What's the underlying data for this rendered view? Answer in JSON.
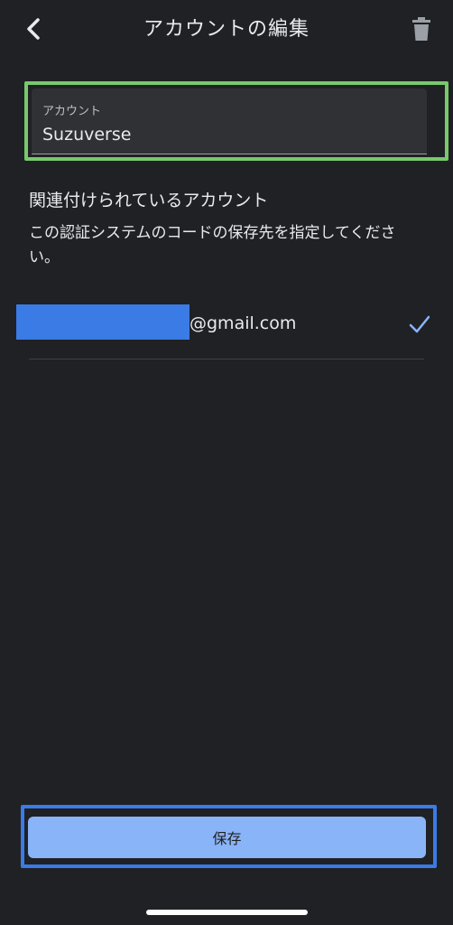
{
  "header": {
    "title": "アカウントの編集",
    "back_icon": "chevron-left-icon",
    "delete_icon": "trash-icon"
  },
  "account_field": {
    "label": "アカウント",
    "value": "Suzuverse"
  },
  "linked_account": {
    "title": "関連付けられているアカウント",
    "description": "この認証システムのコードの保存先を指定してください。",
    "email_domain": "@gmail.com",
    "selected": true,
    "check_icon": "check-icon"
  },
  "save_button": {
    "label": "保存"
  },
  "colors": {
    "background": "#202124",
    "field_highlight": "#77c96b",
    "save_highlight": "#3a7be5",
    "redaction": "#3a7be5",
    "accent": "#8ab4f8"
  }
}
